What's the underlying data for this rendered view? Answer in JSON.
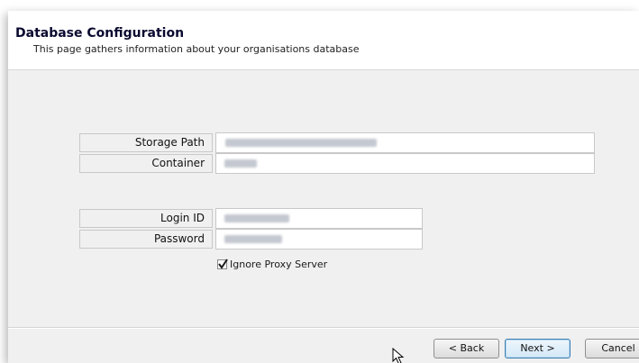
{
  "header": {
    "title": "Database Configuration",
    "subtitle": "This page gathers information about your organisations database"
  },
  "form": {
    "storage_path_label": "Storage Path",
    "container_label": "Container",
    "login_id_label": "Login ID",
    "password_label": "Password",
    "ignore_proxy_label": "Ignore Proxy Server",
    "ignore_proxy_checked": true
  },
  "buttons": {
    "back": "< Back",
    "next": "Next >",
    "cancel": "Cancel"
  },
  "icons": {
    "checkbox": "checkmark-icon",
    "cursor": "mouse-pointer-icon"
  }
}
